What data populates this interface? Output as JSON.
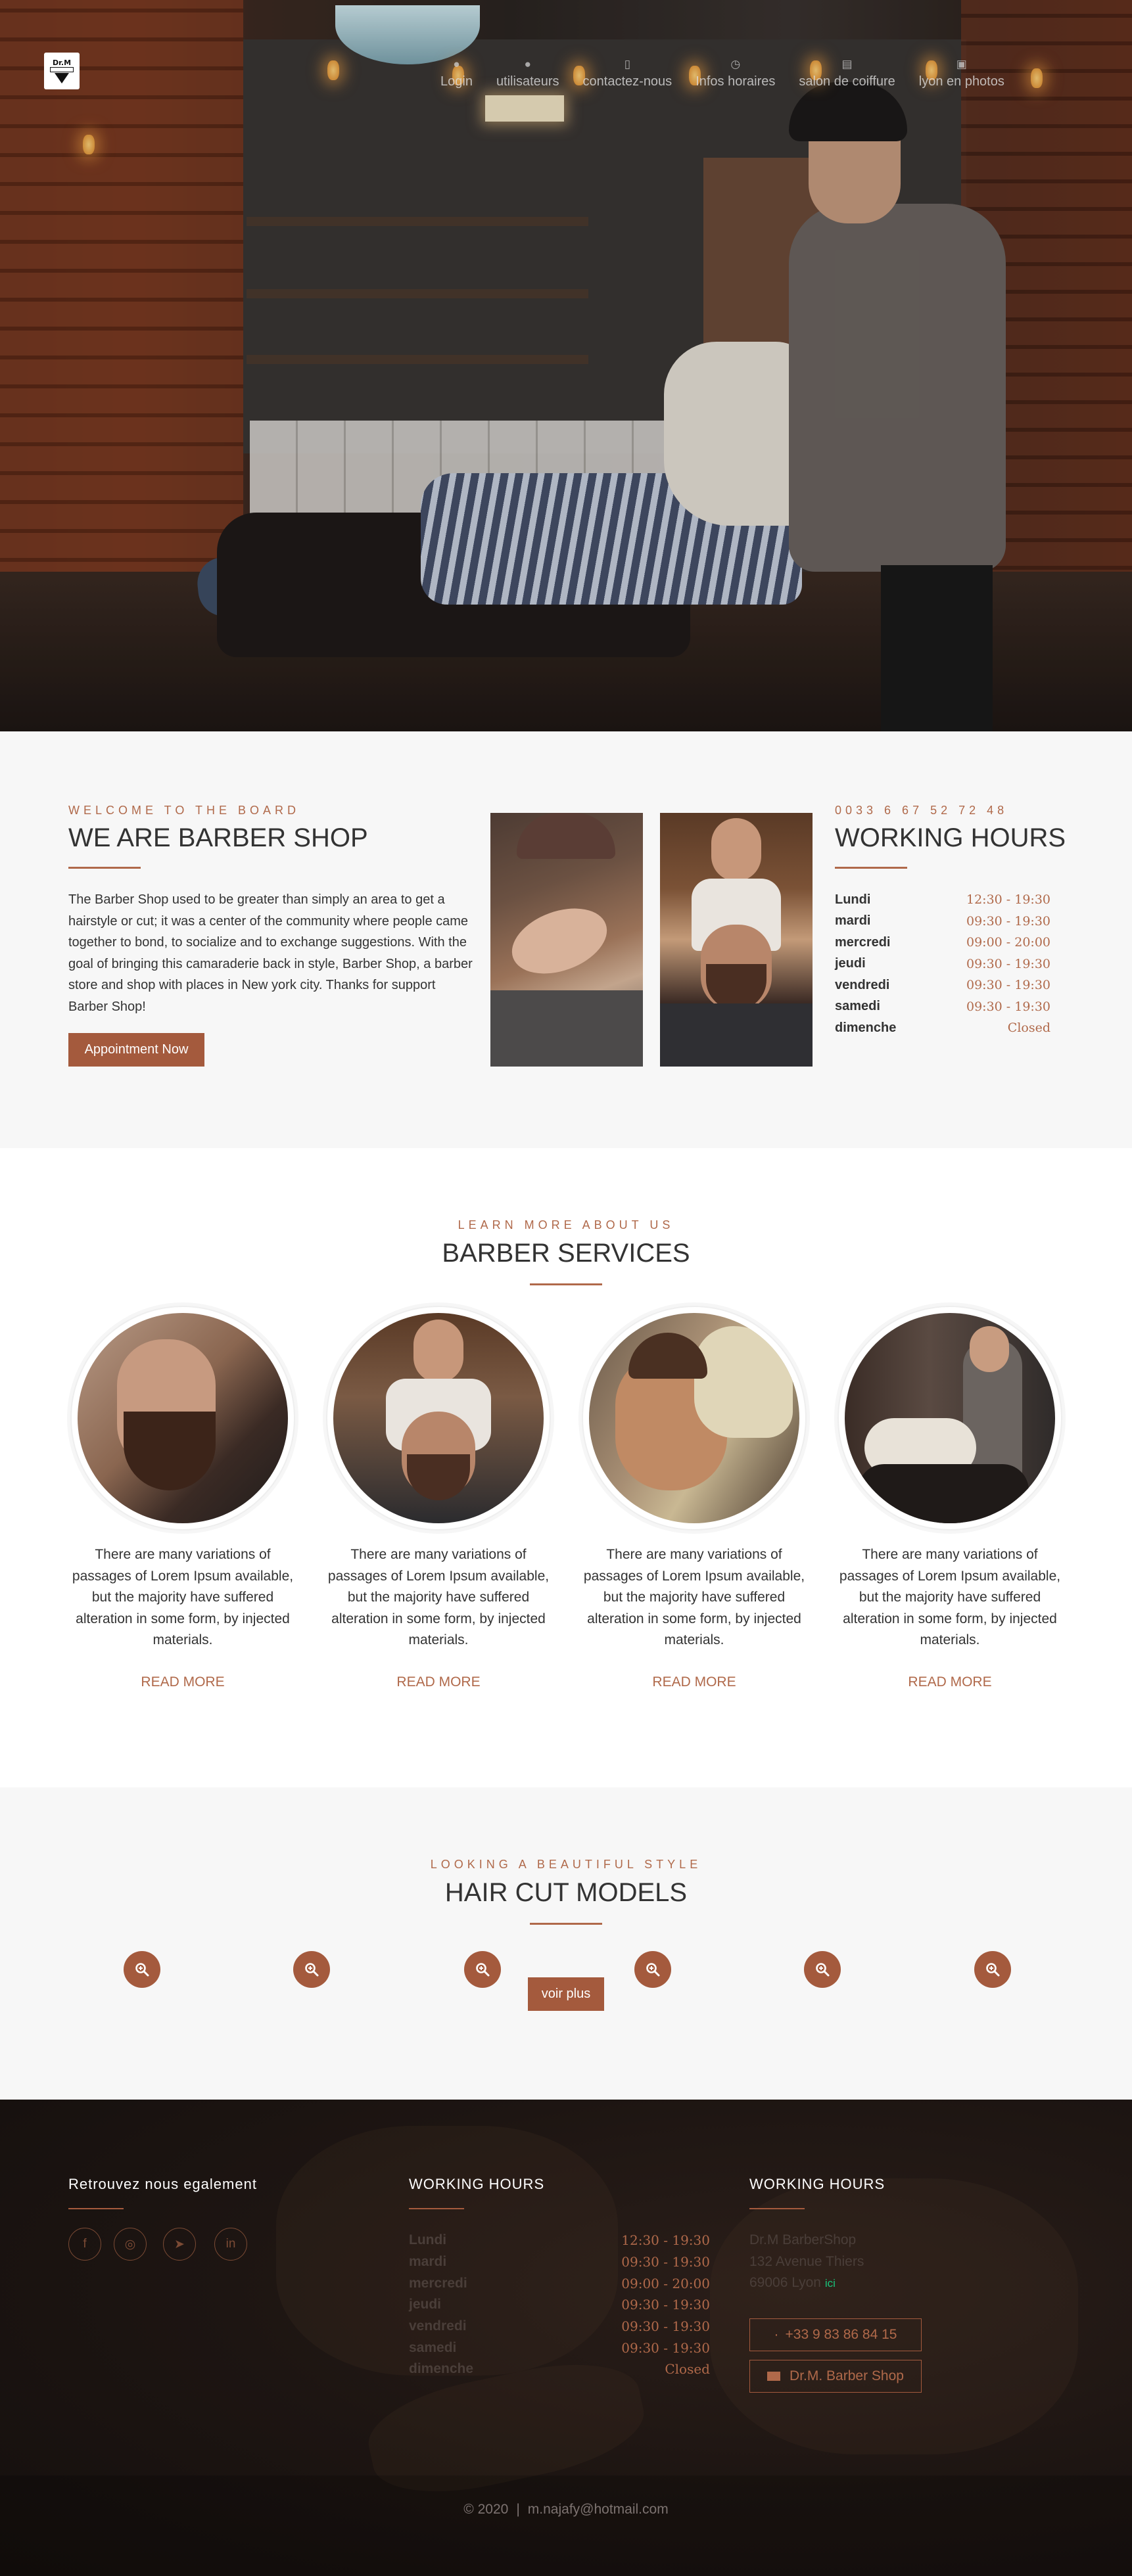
{
  "logo": {
    "line1": "Dr.M",
    "line2": "BARBERSHOP"
  },
  "nav": [
    {
      "label": "Login",
      "icon": "user-icon",
      "glyph": "●"
    },
    {
      "label": "utilisateurs",
      "icon": "users-icon",
      "glyph": "●"
    },
    {
      "label": "contactez-nous",
      "icon": "mobile-icon",
      "glyph": "▯"
    },
    {
      "label": "Infos horaires",
      "icon": "clock-icon",
      "glyph": "◷"
    },
    {
      "label": "salon de coiffure",
      "icon": "store-icon",
      "glyph": "▤"
    },
    {
      "label": "lyon en photos",
      "icon": "photo-icon",
      "glyph": "▣"
    }
  ],
  "about": {
    "eyebrow": "WELCOME TO THE BOARD",
    "title": "WE ARE BARBER SHOP",
    "text": "The Barber Shop used to be greater than simply an area to get a hairstyle or cut; it was a center of the community where people came together to bond, to socialize and to exchange suggestions. With the goal of bringing this camaraderie back in style, Barber Shop, a barber store and shop with places in New york city. Thanks for support Barber Shop!",
    "button": "Appointment Now"
  },
  "hours": {
    "phone": "0033 6 67 52 72 48",
    "title": "WORKING HOURS",
    "rows": [
      {
        "day": "Lundi",
        "time": "12:30 - 19:30"
      },
      {
        "day": "mardi",
        "time": "09:30 - 19:30"
      },
      {
        "day": "mercredi",
        "time": "09:00 - 20:00"
      },
      {
        "day": "jeudi",
        "time": "09:30 - 19:30"
      },
      {
        "day": "vendredi",
        "time": "09:30 - 19:30"
      },
      {
        "day": "samedi",
        "time": "09:30 - 19:30"
      },
      {
        "day": "dimenche",
        "time": "Closed"
      }
    ]
  },
  "services": {
    "eyebrow": "LEARN MORE ABOUT US",
    "title": "BARBER SERVICES",
    "items": [
      {
        "text": "There are many variations of passages of Lorem Ipsum available, but the majority have suffered alteration in some form, by injected materials.",
        "more": "READ MORE"
      },
      {
        "text": "There are many variations of passages of Lorem Ipsum available, but the majority have suffered alteration in some form, by injected materials.",
        "more": "READ MORE"
      },
      {
        "text": "There are many variations of passages of Lorem Ipsum available, but the majority have suffered alteration in some form, by injected materials.",
        "more": "READ MORE"
      },
      {
        "text": "There are many variations of passages of Lorem Ipsum available, but the majority have suffered alteration in some form, by injected materials.",
        "more": "READ MORE"
      }
    ]
  },
  "models": {
    "eyebrow": "LOOKING A BEAUTIFUL STYLE",
    "title": "HAIR CUT MODELS",
    "button": "voir plus",
    "zoom_icon": "zoom-in-icon"
  },
  "footer": {
    "col1_title": "Retrouvez nous egalement",
    "socials": [
      {
        "name": "facebook-icon",
        "glyph": "f"
      },
      {
        "name": "instagram-icon",
        "glyph": "◎"
      },
      {
        "name": "telegram-icon",
        "glyph": "➤"
      },
      {
        "name": "linkedin-icon",
        "glyph": "in"
      }
    ],
    "col2_title": "WORKING HOURS",
    "col3_title": "WORKING HOURS",
    "address": {
      "name": "Dr.M BarberShop",
      "street": "132 Avenue Thiers",
      "city": "69006 Lyon",
      "link": "ici"
    },
    "phone_button": "+33 9 83 86 84 15",
    "shop_button": "Dr.M. Barber Shop",
    "year": "© 2020",
    "email": "m.najafy@hotmail.com"
  },
  "colors": {
    "accent": "#a45a3d",
    "accent_text": "#b0694a",
    "light_bg": "#f7f7f7",
    "footer_bg": "#1d1512"
  }
}
